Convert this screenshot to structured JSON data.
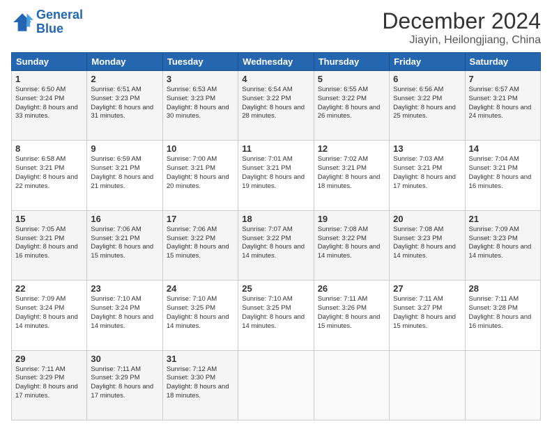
{
  "logo": {
    "line1": "General",
    "line2": "Blue"
  },
  "header": {
    "month": "December 2024",
    "location": "Jiayin, Heilongjiang, China"
  },
  "columns": [
    "Sunday",
    "Monday",
    "Tuesday",
    "Wednesday",
    "Thursday",
    "Friday",
    "Saturday"
  ],
  "weeks": [
    [
      {
        "day": "1",
        "sunrise": "6:50 AM",
        "sunset": "3:24 PM",
        "daylight": "8 hours and 33 minutes."
      },
      {
        "day": "2",
        "sunrise": "6:51 AM",
        "sunset": "3:23 PM",
        "daylight": "8 hours and 31 minutes."
      },
      {
        "day": "3",
        "sunrise": "6:53 AM",
        "sunset": "3:23 PM",
        "daylight": "8 hours and 30 minutes."
      },
      {
        "day": "4",
        "sunrise": "6:54 AM",
        "sunset": "3:22 PM",
        "daylight": "8 hours and 28 minutes."
      },
      {
        "day": "5",
        "sunrise": "6:55 AM",
        "sunset": "3:22 PM",
        "daylight": "8 hours and 26 minutes."
      },
      {
        "day": "6",
        "sunrise": "6:56 AM",
        "sunset": "3:22 PM",
        "daylight": "8 hours and 25 minutes."
      },
      {
        "day": "7",
        "sunrise": "6:57 AM",
        "sunset": "3:21 PM",
        "daylight": "8 hours and 24 minutes."
      }
    ],
    [
      {
        "day": "8",
        "sunrise": "6:58 AM",
        "sunset": "3:21 PM",
        "daylight": "8 hours and 22 minutes."
      },
      {
        "day": "9",
        "sunrise": "6:59 AM",
        "sunset": "3:21 PM",
        "daylight": "8 hours and 21 minutes."
      },
      {
        "day": "10",
        "sunrise": "7:00 AM",
        "sunset": "3:21 PM",
        "daylight": "8 hours and 20 minutes."
      },
      {
        "day": "11",
        "sunrise": "7:01 AM",
        "sunset": "3:21 PM",
        "daylight": "8 hours and 19 minutes."
      },
      {
        "day": "12",
        "sunrise": "7:02 AM",
        "sunset": "3:21 PM",
        "daylight": "8 hours and 18 minutes."
      },
      {
        "day": "13",
        "sunrise": "7:03 AM",
        "sunset": "3:21 PM",
        "daylight": "8 hours and 17 minutes."
      },
      {
        "day": "14",
        "sunrise": "7:04 AM",
        "sunset": "3:21 PM",
        "daylight": "8 hours and 16 minutes."
      }
    ],
    [
      {
        "day": "15",
        "sunrise": "7:05 AM",
        "sunset": "3:21 PM",
        "daylight": "8 hours and 16 minutes."
      },
      {
        "day": "16",
        "sunrise": "7:06 AM",
        "sunset": "3:21 PM",
        "daylight": "8 hours and 15 minutes."
      },
      {
        "day": "17",
        "sunrise": "7:06 AM",
        "sunset": "3:22 PM",
        "daylight": "8 hours and 15 minutes."
      },
      {
        "day": "18",
        "sunrise": "7:07 AM",
        "sunset": "3:22 PM",
        "daylight": "8 hours and 14 minutes."
      },
      {
        "day": "19",
        "sunrise": "7:08 AM",
        "sunset": "3:22 PM",
        "daylight": "8 hours and 14 minutes."
      },
      {
        "day": "20",
        "sunrise": "7:08 AM",
        "sunset": "3:23 PM",
        "daylight": "8 hours and 14 minutes."
      },
      {
        "day": "21",
        "sunrise": "7:09 AM",
        "sunset": "3:23 PM",
        "daylight": "8 hours and 14 minutes."
      }
    ],
    [
      {
        "day": "22",
        "sunrise": "7:09 AM",
        "sunset": "3:24 PM",
        "daylight": "8 hours and 14 minutes."
      },
      {
        "day": "23",
        "sunrise": "7:10 AM",
        "sunset": "3:24 PM",
        "daylight": "8 hours and 14 minutes."
      },
      {
        "day": "24",
        "sunrise": "7:10 AM",
        "sunset": "3:25 PM",
        "daylight": "8 hours and 14 minutes."
      },
      {
        "day": "25",
        "sunrise": "7:10 AM",
        "sunset": "3:25 PM",
        "daylight": "8 hours and 14 minutes."
      },
      {
        "day": "26",
        "sunrise": "7:11 AM",
        "sunset": "3:26 PM",
        "daylight": "8 hours and 15 minutes."
      },
      {
        "day": "27",
        "sunrise": "7:11 AM",
        "sunset": "3:27 PM",
        "daylight": "8 hours and 15 minutes."
      },
      {
        "day": "28",
        "sunrise": "7:11 AM",
        "sunset": "3:28 PM",
        "daylight": "8 hours and 16 minutes."
      }
    ],
    [
      {
        "day": "29",
        "sunrise": "7:11 AM",
        "sunset": "3:29 PM",
        "daylight": "8 hours and 17 minutes."
      },
      {
        "day": "30",
        "sunrise": "7:11 AM",
        "sunset": "3:29 PM",
        "daylight": "8 hours and 17 minutes."
      },
      {
        "day": "31",
        "sunrise": "7:12 AM",
        "sunset": "3:30 PM",
        "daylight": "8 hours and 18 minutes."
      },
      null,
      null,
      null,
      null
    ]
  ]
}
